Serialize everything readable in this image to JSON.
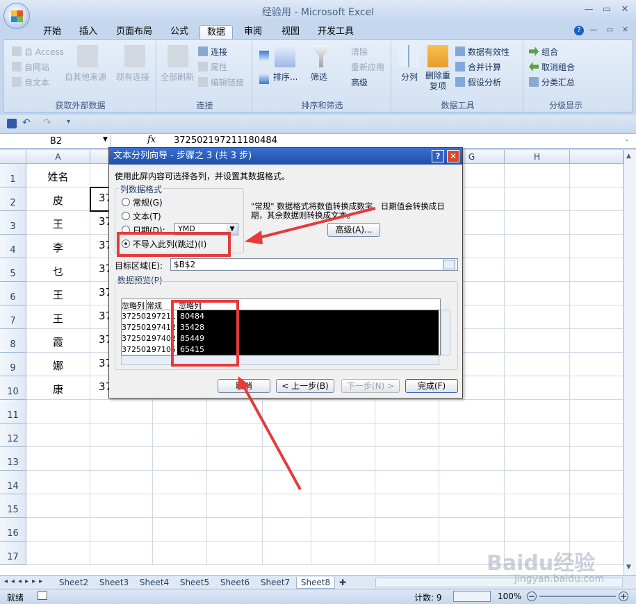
{
  "window": {
    "title": "经验用 - Microsoft Excel"
  },
  "tabs": [
    "开始",
    "插入",
    "页面布局",
    "公式",
    "数据",
    "审阅",
    "视图",
    "开发工具"
  ],
  "active_tab": "数据",
  "ribbon": {
    "get_external": {
      "label": "获取外部数据",
      "access": "自 Access",
      "web": "自网站",
      "text": "自文本",
      "other": "自其他来源",
      "existing": "现有连接"
    },
    "connections": {
      "label": "连接",
      "refresh_all": "全部刷新",
      "connections": "连接",
      "properties": "属性",
      "edit_links": "编辑链接"
    },
    "sort_filter": {
      "label": "排序和筛选",
      "sort": "排序...",
      "filter": "筛选",
      "clear": "清除",
      "reapply": "重新应用",
      "advanced": "高级"
    },
    "data_tools": {
      "label": "数据工具",
      "text_to_columns": "分列",
      "remove_duplicates": "删除重复项",
      "validation": "数据有效性",
      "consolidate": "合并计算",
      "what_if": "假设分析"
    },
    "outline": {
      "label": "分级显示",
      "group": "组合",
      "ungroup": "取消组合",
      "subtotal": "分类汇总"
    }
  },
  "formula_bar": {
    "name_box": "B2",
    "fx": "fx",
    "value": "372502197211180484"
  },
  "columns": [
    "A",
    "B",
    "C",
    "D",
    "E",
    "F",
    "G",
    "H"
  ],
  "rows": [
    "1",
    "2",
    "3",
    "4",
    "5",
    "6",
    "7",
    "8",
    "9",
    "10",
    "11",
    "12",
    "13",
    "14",
    "15",
    "16",
    "17"
  ],
  "col_a": [
    "姓名",
    "皮",
    "王",
    "李",
    "乜",
    "王",
    "王",
    "霞",
    "娜",
    "康"
  ],
  "col_b_partial": [
    "",
    "37",
    "37",
    "37",
    "37",
    "37",
    "37",
    "37",
    "37",
    "37"
  ],
  "dialog": {
    "title": "文本分列向导 - 步骤之 3 (共 3 步)",
    "intro": "使用此屏内容可选择各列，并设置其数据格式。",
    "group_format": "列数据格式",
    "opt_general": "常规(G)",
    "opt_text": "文本(T)",
    "opt_date": "日期(D):",
    "date_format": "YMD",
    "opt_skip": "不导入此列(跳过)(I)",
    "desc": "\"常规\" 数据格式将数值转换成数字，日期值会转换成日期，其余数据则转换成文本。",
    "advanced": "高级(A)...",
    "dest_label": "目标区域(E):",
    "dest_value": "$B$2",
    "preview_label": "数据预览(P)",
    "preview_headers": [
      "忽略列",
      "常规",
      "忽略列"
    ],
    "preview_rows": [
      [
        "372502",
        "197211",
        "80484"
      ],
      [
        "372502",
        "197412",
        "35428"
      ],
      [
        "372502",
        "197402",
        "85449"
      ],
      [
        "372502",
        "197105",
        "65415"
      ]
    ],
    "cancel": "取消",
    "back": "< 上一步(B)",
    "next": "下一步(N) >",
    "finish": "完成(F)"
  },
  "sheets": [
    "Sheet2",
    "Sheet3",
    "Sheet4",
    "Sheet5",
    "Sheet6",
    "Sheet7",
    "Sheet8"
  ],
  "active_sheet": "Sheet8",
  "status": {
    "ready": "就绪",
    "count": "计数: 9",
    "zoom": "100%"
  },
  "watermark": {
    "brand": "Baidu经验",
    "url": "jingyan.baidu.com"
  },
  "colors": {
    "annotation": "#e43b3b",
    "title_blue": "#1f4fa8"
  }
}
